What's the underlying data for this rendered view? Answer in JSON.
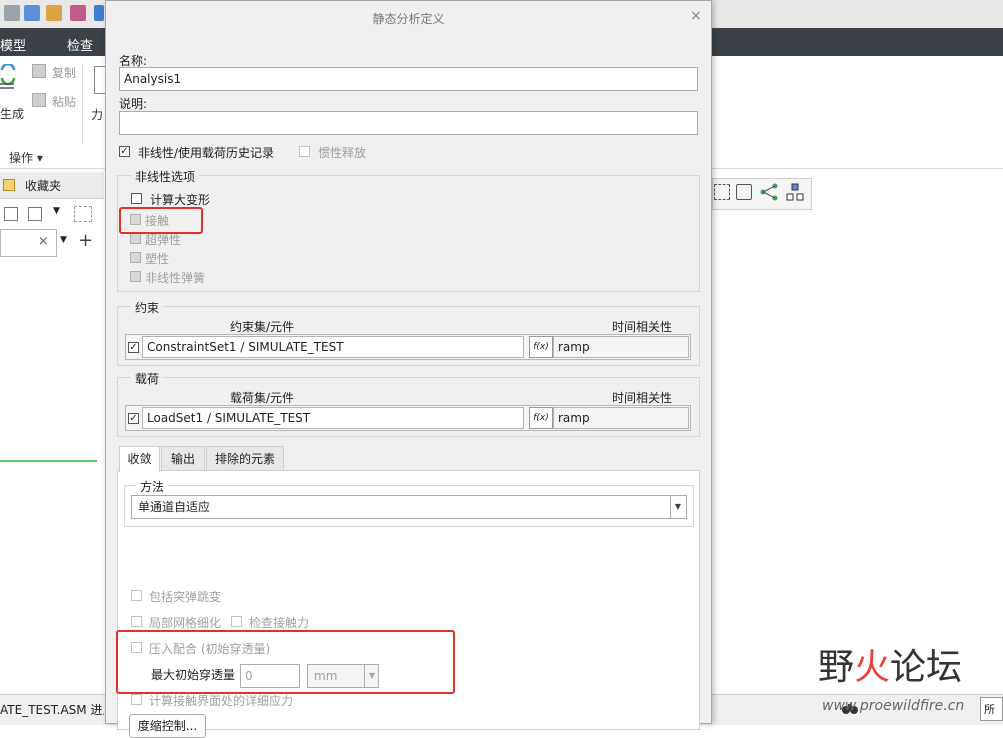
{
  "app": {
    "menu": [
      "模型",
      "检查"
    ],
    "ribbon": {
      "copy": "复制",
      "paste": "粘贴",
      "generate": "生成",
      "force": "力",
      "operations": "操作"
    },
    "favorites_tab": "收藏夹",
    "status_text": "ATE_TEST.ASM 进入 C",
    "status_select": "所有"
  },
  "watermark": {
    "part1": "野",
    "part2": "火",
    "part3": "论坛",
    "url": "www.proewildfire.cn"
  },
  "dialog": {
    "title": "静态分析定义",
    "close_glyph": "×",
    "name_label": "名称:",
    "name_value": "Analysis1",
    "desc_label": "说明:",
    "desc_value": "",
    "nonlinear_label": "非线性/使用载荷历史记录",
    "nonlinear_checked": true,
    "inertia_label": "惯性释放",
    "nonlinear_options": {
      "title": "非线性选项",
      "large_deformation": "计算大变形",
      "contact": "接触",
      "hyperelastic": "超弹性",
      "plasticity": "塑性",
      "nonlinear_spring": "非线性弹簧"
    },
    "constraints": {
      "title": "约束",
      "col_set": "约束集/元件",
      "col_time": "时间相关性",
      "row_value": "ConstraintSet1 / SIMULATE_TEST",
      "time_value": "ramp",
      "fx_label": "f(x)"
    },
    "loads": {
      "title": "载荷",
      "col_set": "载荷集/元件",
      "col_time": "时间相关性",
      "row_value": "LoadSet1 / SIMULATE_TEST",
      "time_value": "ramp",
      "fx_label": "f(x)"
    },
    "tabs": [
      "收敛",
      "输出",
      "排除的元素"
    ],
    "method": {
      "title": "方法",
      "value": "单通道自适应"
    },
    "options": {
      "snap_through": "包括突弹跳变",
      "local_mesh": "局部网格细化",
      "check_contact": "检查接触力",
      "press_fit": "压入配合 (初始穿透量)",
      "max_penetration_label": "最大初始穿透量",
      "max_penetration_value": "0",
      "unit": "mm",
      "detailed_stress": "计算接触界面处的详细应力",
      "bottom_button": "度缩控制..."
    }
  },
  "colors": {
    "highlight": "#e0312b",
    "menu_bar": "#3b4147"
  }
}
